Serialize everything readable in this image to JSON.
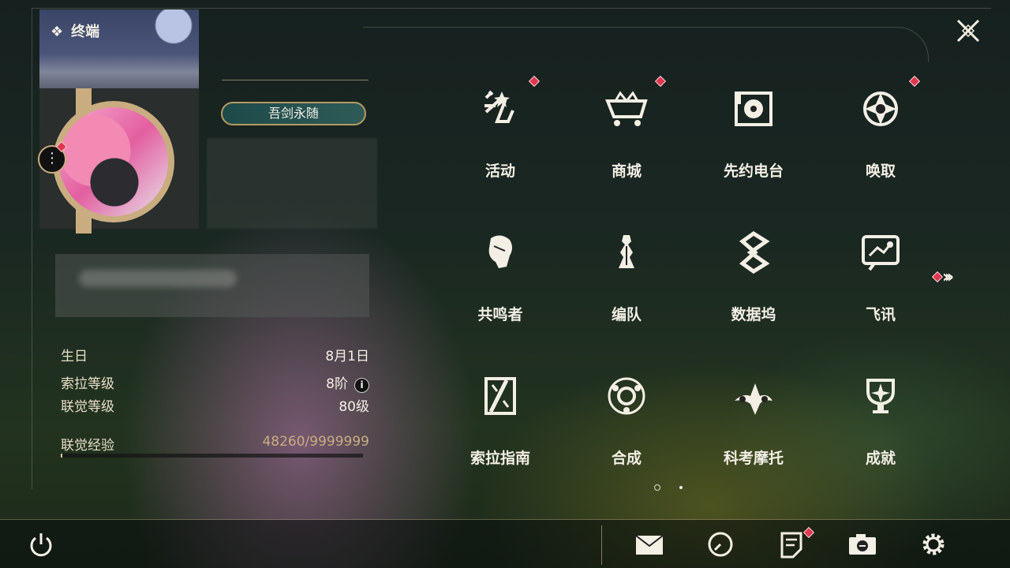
{
  "window": {
    "title": "终端"
  },
  "profile": {
    "title_badge": "吾剑永随",
    "stats": [
      {
        "label": "生日",
        "value": "8月1日"
      },
      {
        "label": "索拉等级",
        "value": "8阶"
      },
      {
        "label": "联觉等级",
        "value": "80级"
      }
    ],
    "xp": {
      "label": "联觉经验",
      "value": "48260/9999999",
      "progress": 0.0048
    }
  },
  "menu": {
    "items": [
      {
        "label": "活动",
        "icon": "activity-icon",
        "badge": true
      },
      {
        "label": "商城",
        "icon": "shop-icon",
        "badge": true
      },
      {
        "label": "先约电台",
        "icon": "radio-icon",
        "badge": false
      },
      {
        "label": "唤取",
        "icon": "summon-icon",
        "badge": true
      },
      {
        "label": "共鸣者",
        "icon": "resonator-icon",
        "badge": false
      },
      {
        "label": "编队",
        "icon": "team-icon",
        "badge": false
      },
      {
        "label": "数据坞",
        "icon": "data-bank-icon",
        "badge": false
      },
      {
        "label": "飞讯",
        "icon": "message-icon",
        "badge": false
      },
      {
        "label": "索拉指南",
        "icon": "guide-icon",
        "badge": false
      },
      {
        "label": "合成",
        "icon": "synthesis-icon",
        "badge": false
      },
      {
        "label": "科考摩托",
        "icon": "motorcycle-icon",
        "badge": false
      },
      {
        "label": "成就",
        "icon": "achievement-icon",
        "badge": false
      }
    ],
    "pages": 2,
    "current_page": 1
  },
  "bottom_bar": {
    "icons": [
      "power-icon",
      "mail-icon",
      "clock-icon",
      "notes-icon",
      "camera-icon",
      "settings-icon"
    ]
  },
  "colors": {
    "accent_gold": "#c9ad80",
    "badge_red": "#e0374f",
    "text": "#f3efe5"
  }
}
